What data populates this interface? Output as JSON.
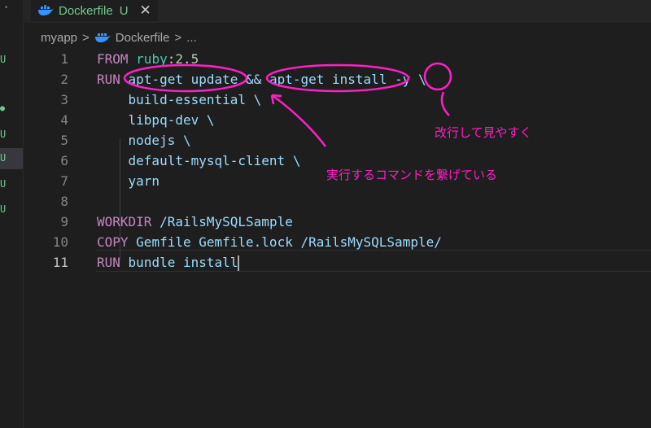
{
  "tab": {
    "label": "Dockerfile",
    "status": "U",
    "close": "✕"
  },
  "breadcrumb": {
    "folder": "myapp",
    "sep": ">",
    "file": "Dockerfile",
    "more": "..."
  },
  "sidebar_marks": [
    "U",
    "U",
    "U",
    "U",
    "U"
  ],
  "colors": {
    "annotation": "#ff1fc8",
    "untracked": "#73c991"
  },
  "lines": [
    {
      "n": "1",
      "tokens": [
        {
          "t": "FROM",
          "c": "kw"
        },
        {
          "t": " "
        },
        {
          "t": "ruby",
          "c": "ruby"
        },
        {
          "t": ":"
        },
        {
          "t": "2.5",
          "c": "num"
        }
      ]
    },
    {
      "n": "2",
      "tokens": [
        {
          "t": "RUN",
          "c": "kw"
        },
        {
          "t": " "
        },
        {
          "t": "apt-get update &&",
          "c": "str"
        },
        {
          "t": " "
        },
        {
          "t": "apt-get install -y \\",
          "c": "str"
        }
      ]
    },
    {
      "n": "3",
      "tokens": [
        {
          "t": "    build-essential \\",
          "c": "str"
        }
      ]
    },
    {
      "n": "4",
      "tokens": [
        {
          "t": "    libpq-dev \\",
          "c": "str"
        }
      ]
    },
    {
      "n": "5",
      "tokens": [
        {
          "t": "    nodejs \\",
          "c": "str"
        }
      ]
    },
    {
      "n": "6",
      "tokens": [
        {
          "t": "    default-mysql-client \\",
          "c": "str"
        }
      ]
    },
    {
      "n": "7",
      "tokens": [
        {
          "t": "    yarn",
          "c": "str"
        }
      ]
    },
    {
      "n": "8",
      "tokens": []
    },
    {
      "n": "9",
      "tokens": [
        {
          "t": "WORKDIR",
          "c": "kw"
        },
        {
          "t": " "
        },
        {
          "t": "/RailsMySQLSample",
          "c": "str"
        }
      ]
    },
    {
      "n": "10",
      "tokens": [
        {
          "t": "COPY",
          "c": "kw"
        },
        {
          "t": " "
        },
        {
          "t": "Gemfile Gemfile.lock /RailsMySQLSample/",
          "c": "str"
        }
      ]
    },
    {
      "n": "11",
      "tokens": [
        {
          "t": "RUN",
          "c": "kw"
        },
        {
          "t": " "
        },
        {
          "t": "bundle install",
          "c": "str"
        }
      ]
    }
  ],
  "annotations": {
    "newline_note": "改行して見やすく",
    "chain_note": "実行するコマンドを繋げている"
  }
}
